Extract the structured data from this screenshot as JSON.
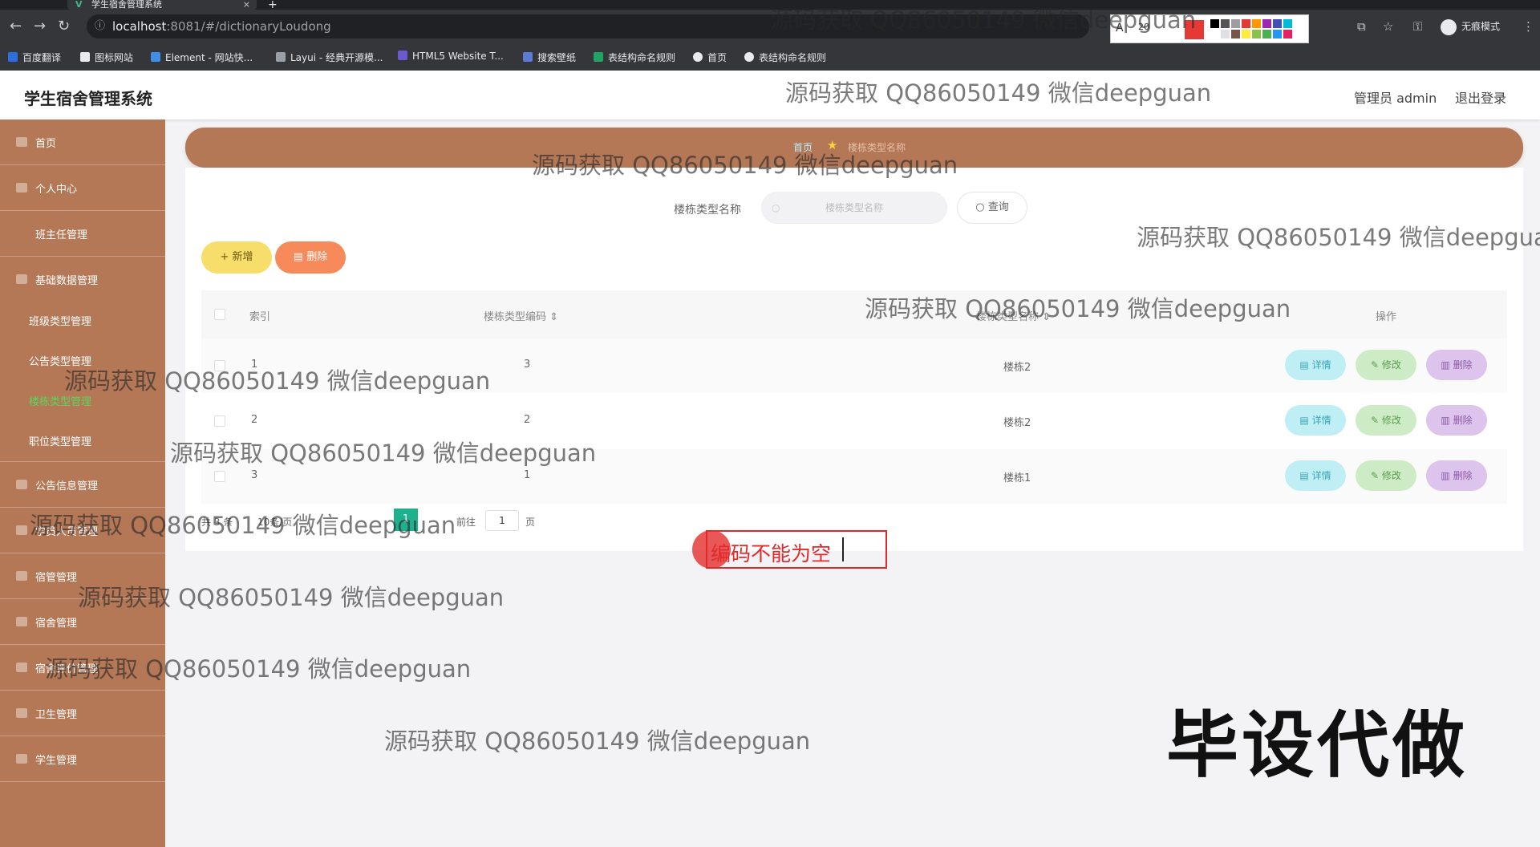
{
  "browser": {
    "tab_title": "学生宿舍管理系统",
    "url_host": "localhost",
    "url_path": ":8081/#/dictionaryLoudong",
    "incognito_label": "无痕模式",
    "draw_tool_size": "20",
    "draw_tool_colors": [
      "#000000",
      "#555555",
      "#9e9e9e",
      "#e53935",
      "#ff9800",
      "#9c27b0",
      "#3f51b5",
      "#00bcd4",
      "#ffffff",
      "#e0e0e0",
      "#795548",
      "#ffeb3b",
      "#8bc34a",
      "#4caf50",
      "#2196f3",
      "#e91e63"
    ],
    "bookmarks": [
      "百度翻译",
      "图标网站",
      "Element - 网站快...",
      "Layui - 经典开源模...",
      "HTML5 Website T...",
      "搜索壁纸",
      "表结构命名规则",
      "首页",
      "表结构命名规则"
    ]
  },
  "app": {
    "title": "学生宿舍管理系统",
    "user_label": "管理员 admin",
    "logout_label": "退出登录"
  },
  "sidebar": {
    "items": [
      {
        "label": "首页"
      },
      {
        "label": "个人中心"
      },
      {
        "label": "班主任管理"
      },
      {
        "label": "基础数据管理"
      },
      {
        "label": "班级类型管理"
      },
      {
        "label": "公告类型管理"
      },
      {
        "label": "楼栋类型管理"
      },
      {
        "label": "职位类型管理"
      },
      {
        "label": "公告信息管理"
      },
      {
        "label": "学员人员管理"
      },
      {
        "label": "宿管管理"
      },
      {
        "label": "宿舍管理"
      },
      {
        "label": "宿舍评价管理"
      },
      {
        "label": "卫生管理"
      },
      {
        "label": "学生管理"
      }
    ]
  },
  "breadcrumb": {
    "home": "首页",
    "current": "楼栋类型名称"
  },
  "search": {
    "label": "楼栋类型名称",
    "placeholder": "楼栋类型名称",
    "button": "查询"
  },
  "actions": {
    "add": "新增",
    "delete": "删除"
  },
  "table": {
    "columns": [
      "索引",
      "楼栋类型编码",
      "楼栋类型名称",
      "操作"
    ],
    "rows": [
      {
        "index": "1",
        "code": "3",
        "name": "楼栋2"
      },
      {
        "index": "2",
        "code": "2",
        "name": "楼栋2"
      },
      {
        "index": "3",
        "code": "1",
        "name": "楼栋1"
      }
    ],
    "row_actions": {
      "detail": "详情",
      "edit": "修改",
      "remove": "删除"
    }
  },
  "pagination": {
    "total_text": "共 3 条",
    "page_size_text": "10条/页",
    "current_page": "1",
    "goto_label": "前往",
    "goto_value": "1",
    "page_suffix": "页"
  },
  "annotation": {
    "error_text": "编码不能为空"
  },
  "watermark": {
    "text": "源码获取 QQ86050149 微信deepguan",
    "promo": "毕设代做"
  }
}
